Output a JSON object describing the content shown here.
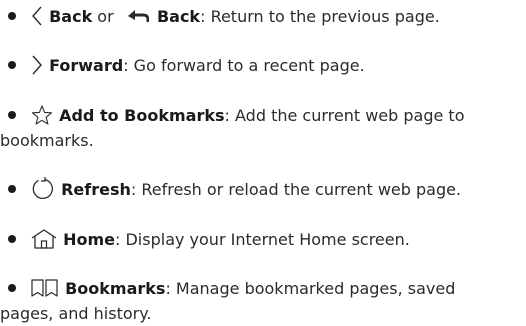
{
  "items": [
    {
      "icon": "chevron-left-icon",
      "term": "Back",
      "joiner": " or ",
      "icon2": "back-arrow-icon",
      "term2": "Back",
      "sep": ": ",
      "desc": "Return to the previous page."
    },
    {
      "icon": "chevron-right-icon",
      "term": "Forward",
      "sep": ": ",
      "desc": "Go forward to a recent page."
    },
    {
      "icon": "star-outline-icon",
      "term": "Add to Bookmarks",
      "sep": ": ",
      "desc": "Add the current web page to",
      "desc_line2": "bookmarks."
    },
    {
      "icon": "refresh-icon",
      "term": "Refresh",
      "sep": ": ",
      "desc": "Refresh or reload the current web page."
    },
    {
      "icon": "home-icon",
      "term": "Home",
      "sep": ": ",
      "desc": "Display your Internet Home screen."
    },
    {
      "icon": "bookmarks-book-icon",
      "term": "Bookmarks",
      "sep": ": ",
      "desc": "Manage bookmarked pages, saved",
      "desc_line2": "pages, and history."
    }
  ]
}
